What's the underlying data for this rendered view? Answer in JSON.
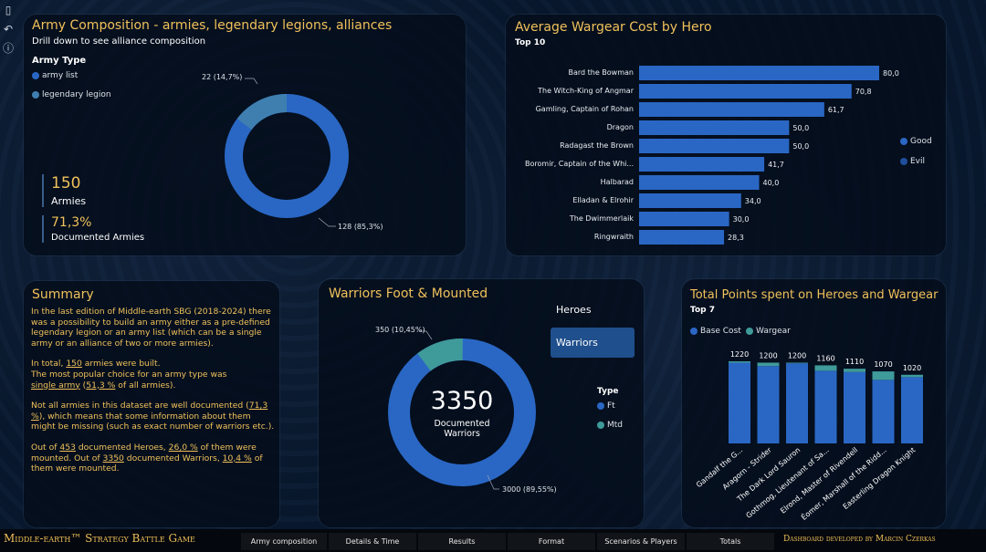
{
  "toolbar_icons": [
    "bookmark-icon",
    "undo-icon",
    "help-icon"
  ],
  "army_composition": {
    "title": "Army Composition - armies, legendary legions, alliances",
    "subtitle": "Drill down to see alliance composition",
    "legend_title": "Army Type",
    "legend": [
      {
        "label": "army list",
        "color": "#2a67c4"
      },
      {
        "label": "legendary legion",
        "color": "#3f7fb0"
      }
    ],
    "kpi1_value": "150",
    "kpi1_label": "Armies",
    "kpi2_value": "71,3%",
    "kpi2_label": "Documented Armies",
    "slice_small_label": "22 (14,7%)",
    "slice_big_label": "128 (85,3%)"
  },
  "wargear": {
    "title": "Average Wargear Cost by Hero",
    "subtitle": "Top 10",
    "legend": [
      {
        "label": "Good",
        "color": "#2a67c4"
      },
      {
        "label": "Evil",
        "color": "#1f4f9c"
      }
    ],
    "bars": [
      {
        "name": "Bard the Bowman",
        "value": 80.0,
        "label": "80,0"
      },
      {
        "name": "The Witch-King of Angmar",
        "value": 70.8,
        "label": "70,8"
      },
      {
        "name": "Gamling, Captain of Rohan",
        "value": 61.7,
        "label": "61,7"
      },
      {
        "name": "Dragon",
        "value": 50.0,
        "label": "50,0"
      },
      {
        "name": "Radagast the Brown",
        "value": 50.0,
        "label": "50,0"
      },
      {
        "name": "Boromir, Captain of the Whi...",
        "value": 41.7,
        "label": "41,7"
      },
      {
        "name": "Halbarad",
        "value": 40.0,
        "label": "40,0"
      },
      {
        "name": "Elladan & Elrohir",
        "value": 34.0,
        "label": "34,0"
      },
      {
        "name": "The Dwimmerlaik",
        "value": 30.0,
        "label": "30,0"
      },
      {
        "name": "Ringwraith",
        "value": 28.3,
        "label": "28,3"
      }
    ]
  },
  "summary": {
    "title": "Summary",
    "p1": "In the last edition of Middle-earth SBG (2018-2024) there was a possibility to build an army either as a pre-defined legendary legion or an army list (which can be a single army or an alliance of two or more armies).",
    "p2a": "In total, ",
    "p2b": "150",
    "p2c": " armies were built.",
    "p2d": "The most popular choice for an army type was",
    "p2e": "single army",
    "p2f": " (",
    "p2g": "51,3 %",
    "p2h": " of all armies).",
    "p3a": "Not all armies in this dataset are well documented (",
    "p3b": "71,3 %",
    "p3c": "), which means that some information about them might be missing (such as exact number of warriors etc.).",
    "p4a": "Out of ",
    "p4b": "453",
    "p4c": " documented Heroes, ",
    "p4d": "26,0 %",
    "p4e": " of them were mounted. Out of ",
    "p4f": "3350",
    "p4g": " documented Warriors, ",
    "p4h": "10,4 %",
    "p4i": " of them were mounted."
  },
  "warriors": {
    "title": "Warriors Foot & Mounted",
    "buttons": [
      "Heroes",
      "Warriors"
    ],
    "center_value": "3350",
    "center_label": "Documented Warriors",
    "legend_title": "Type",
    "legend": [
      {
        "label": "Ft",
        "color": "#2a67c4"
      },
      {
        "label": "Mtd",
        "color": "#3f9a9a"
      }
    ],
    "slice_small_label": "350 (10,45%)",
    "slice_big_label": "3000 (89,55%)"
  },
  "total_points": {
    "title": "Total Points spent on Heroes and Wargear",
    "subtitle": "Top 7",
    "legend": [
      {
        "label": "Base Cost",
        "color": "#2a67c4"
      },
      {
        "label": "Wargear",
        "color": "#3f9a9a"
      }
    ]
  },
  "chart_data": {
    "type": "bar",
    "categories": [
      "Gandalf the G...",
      "Aragorn - Strider",
      "The Dark Lord Sauron",
      "Gothmog, Lieutenant of Sa...",
      "Elrond, Master of Rivendell",
      "Éomer, Marshall of the Ridd...",
      "Easterling Dragon Knight"
    ],
    "totals": [
      1220,
      1200,
      1200,
      1160,
      1110,
      1070,
      1020
    ],
    "series": [
      {
        "name": "Base Cost",
        "values": [
          1200,
          1150,
          1190,
          1080,
          1060,
          945,
          985
        ]
      },
      {
        "name": "Wargear",
        "values": [
          20,
          50,
          10,
          80,
          50,
          125,
          35
        ]
      }
    ],
    "ylim": [
      0,
      1300
    ]
  },
  "footer": {
    "brand_left": "Middle-earth™ Strategy Battle Game",
    "tabs": [
      "Army composition",
      "Details & Time",
      "Results",
      "Format",
      "Scenarios & Players",
      "Totals"
    ],
    "brand_right": "Dashboard developed by Marcin Czerkas"
  }
}
